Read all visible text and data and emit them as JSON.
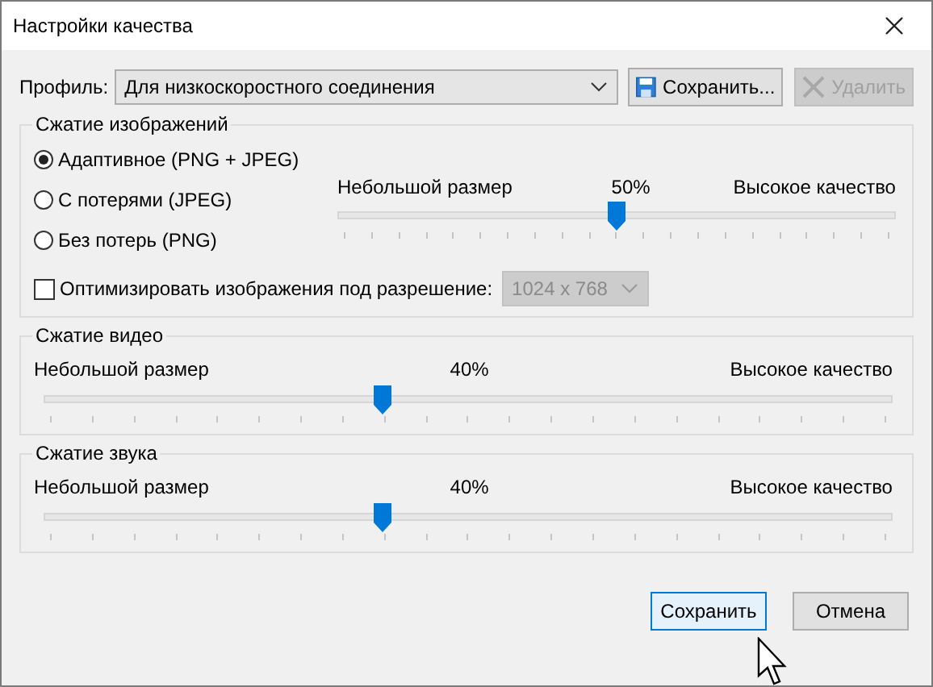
{
  "window": {
    "title": "Настройки качества"
  },
  "profile": {
    "label": "Профиль:",
    "value": "Для низкоскоростного соединения",
    "save_button": "Сохранить...",
    "delete_button": {
      "label": "Удалить",
      "disabled": true
    }
  },
  "groups": [
    {
      "kind": "image",
      "title": "Сжатие изображений",
      "options": [
        {
          "label": "Адаптивное (PNG + JPEG)",
          "selected": true
        },
        {
          "label": "С потерями (JPEG)",
          "selected": false
        },
        {
          "label": "Без потерь (PNG)",
          "selected": false
        }
      ],
      "slider": {
        "min_label": "Небольшой размер",
        "reading": "50%",
        "max_label": "Высокое качество",
        "level": 0.5
      },
      "optimize": {
        "label": "Оптимизировать изображения под разрешение:",
        "checked": false,
        "resolution": "1024 x 768",
        "disabled": true
      }
    },
    {
      "kind": "plain",
      "title": "Сжатие видео",
      "slider": {
        "min_label": "Небольшой размер",
        "reading": "40%",
        "max_label": "Высокое качество",
        "level": 0.4
      }
    },
    {
      "kind": "plain",
      "title": "Сжатие звука",
      "slider": {
        "min_label": "Небольшой размер",
        "reading": "40%",
        "max_label": "Высокое качество",
        "level": 0.4
      }
    }
  ],
  "buttons": [
    {
      "label": "Сохранить",
      "focused": true
    },
    {
      "label": "Отмена",
      "focused": false
    }
  ]
}
